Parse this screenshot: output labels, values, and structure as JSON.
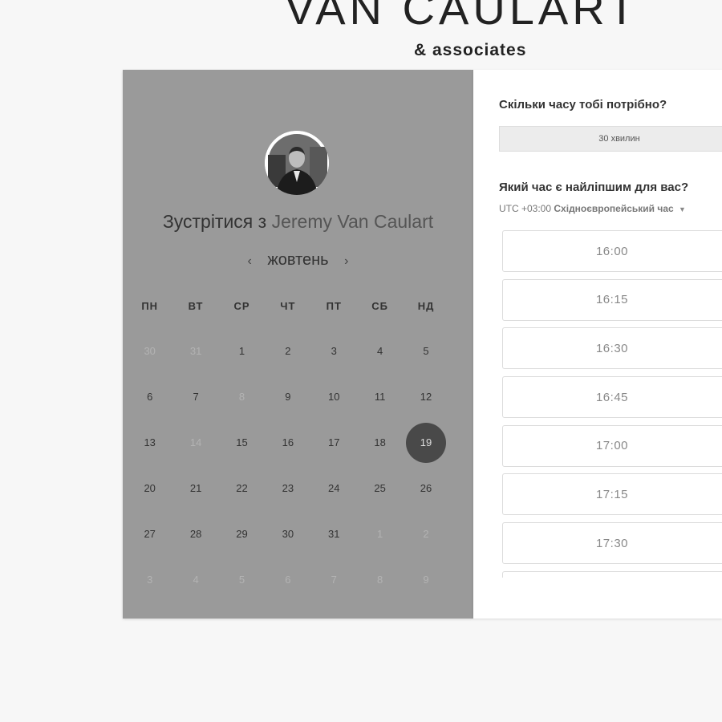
{
  "brand": {
    "title": "VAN CAULART",
    "subtitle": "& associates"
  },
  "host": {
    "prefix": "Зустрітися з",
    "name": "Jeremy Van Caulart"
  },
  "calendar": {
    "month": "жовтень",
    "prev_icon": "chevron-left-icon",
    "next_icon": "chevron-right-icon",
    "weekdays": [
      "ПН",
      "ВТ",
      "СР",
      "ЧТ",
      "ПТ",
      "СБ",
      "НД"
    ],
    "days": [
      {
        "d": "30",
        "muted": true
      },
      {
        "d": "31",
        "muted": true
      },
      {
        "d": "1"
      },
      {
        "d": "2"
      },
      {
        "d": "3"
      },
      {
        "d": "4"
      },
      {
        "d": "5"
      },
      {
        "d": "6"
      },
      {
        "d": "7"
      },
      {
        "d": "8",
        "muted": true
      },
      {
        "d": "9"
      },
      {
        "d": "10"
      },
      {
        "d": "11"
      },
      {
        "d": "12"
      },
      {
        "d": "13"
      },
      {
        "d": "14",
        "muted": true
      },
      {
        "d": "15"
      },
      {
        "d": "16"
      },
      {
        "d": "17"
      },
      {
        "d": "18"
      },
      {
        "d": "19",
        "selected": true
      },
      {
        "d": "20"
      },
      {
        "d": "21"
      },
      {
        "d": "22"
      },
      {
        "d": "23"
      },
      {
        "d": "24"
      },
      {
        "d": "25"
      },
      {
        "d": "26"
      },
      {
        "d": "27"
      },
      {
        "d": "28"
      },
      {
        "d": "29"
      },
      {
        "d": "30"
      },
      {
        "d": "31"
      },
      {
        "d": "1",
        "muted": true
      },
      {
        "d": "2",
        "muted": true
      },
      {
        "d": "3",
        "muted": true
      },
      {
        "d": "4",
        "muted": true
      },
      {
        "d": "5",
        "muted": true
      },
      {
        "d": "6",
        "muted": true
      },
      {
        "d": "7",
        "muted": true
      },
      {
        "d": "8",
        "muted": true
      },
      {
        "d": "9",
        "muted": true
      }
    ]
  },
  "booking": {
    "duration_question": "Скільки часу тобі потрібно?",
    "duration_value": "30 хвилин",
    "time_question": "Який час є найліпшим для вас?",
    "timezone_offset": "UTC +03:00",
    "timezone_name": "Східноєвропейський час",
    "timezone_caret_icon": "caret-down-icon",
    "slots": [
      "16:00",
      "16:15",
      "16:30",
      "16:45",
      "17:00",
      "17:15",
      "17:30",
      ""
    ]
  },
  "colors": {
    "page_bg": "#f7f7f7",
    "calendar_bg": "#9a9a9a",
    "selected_day": "#494949",
    "panel_bg": "#ffffff"
  }
}
